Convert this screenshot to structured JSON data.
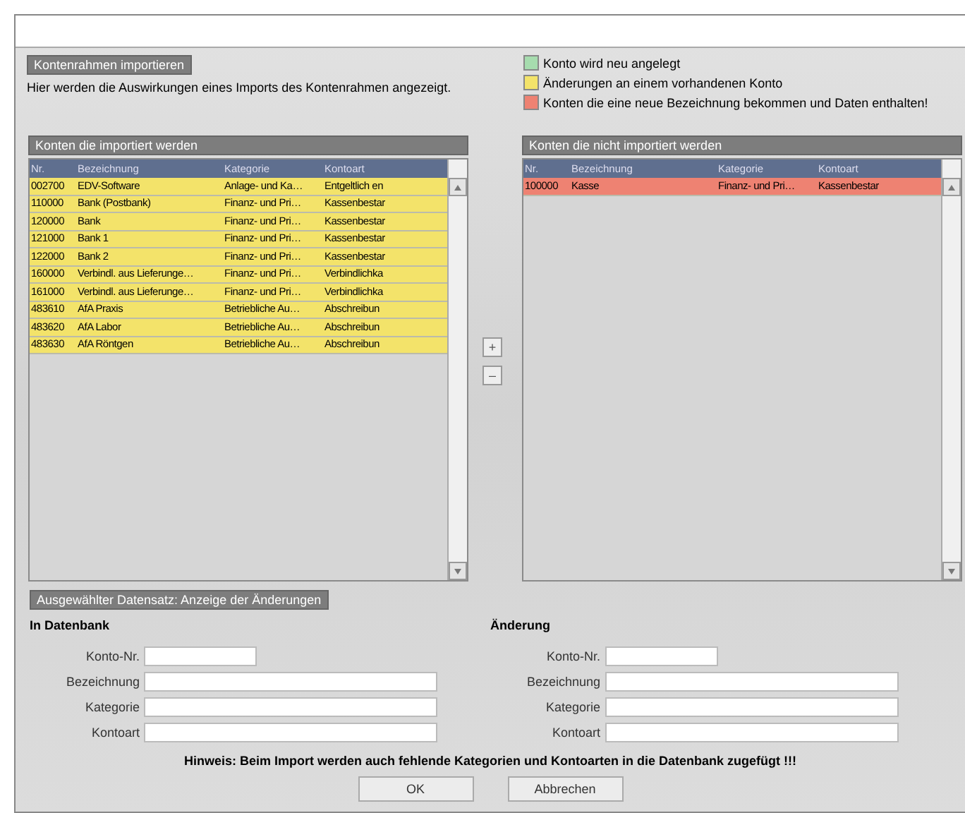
{
  "import_info": {
    "heading": "Kontenrahmen importieren",
    "description": "Hier werden die Auswirkungen eines Imports des Kontenrahmen angezeigt."
  },
  "legend": [
    {
      "label": "Konto wird neu angelegt",
      "color": "#a6dcae"
    },
    {
      "label": "Änderungen an einem vorhandenen Konto",
      "color": "#f3e36a"
    },
    {
      "label": "Konten die eine neue Bezeichnung bekommen und Daten enthalten!",
      "color": "#ee8272"
    }
  ],
  "imported_list": {
    "heading": "Konten die importiert werden",
    "columns": [
      "Nr.",
      "Bezeichnung",
      "Kategorie",
      "Kontoart"
    ],
    "rows": [
      {
        "cells": [
          "002700",
          "EDV-Software",
          "Anlage- und Ka…",
          "Entgeltlich en"
        ],
        "color": "#f3e36a"
      },
      {
        "cells": [
          "110000",
          "Bank (Postbank)",
          "Finanz- und Pri…",
          "Kassenbestar"
        ],
        "color": "#f3e36a"
      },
      {
        "cells": [
          "120000",
          "Bank",
          "Finanz- und Pri…",
          "Kassenbestar"
        ],
        "color": "#f3e36a"
      },
      {
        "cells": [
          "121000",
          "Bank 1",
          "Finanz- und Pri…",
          "Kassenbestar"
        ],
        "color": "#f3e36a"
      },
      {
        "cells": [
          "122000",
          "Bank 2",
          "Finanz- und Pri…",
          "Kassenbestar"
        ],
        "color": "#f3e36a"
      },
      {
        "cells": [
          "160000",
          "Verbindl. aus Lieferunge…",
          "Finanz- und Pri…",
          "Verbindlichka"
        ],
        "color": "#f3e36a"
      },
      {
        "cells": [
          "161000",
          "Verbindl. aus Lieferunge…",
          "Finanz- und Pri…",
          "Verbindlichka"
        ],
        "color": "#f3e36a"
      },
      {
        "cells": [
          "483610",
          "AfA Praxis",
          "Betriebliche Au…",
          "Abschreibun"
        ],
        "color": "#f3e36a"
      },
      {
        "cells": [
          "483620",
          "AfA Labor",
          "Betriebliche Au…",
          "Abschreibun"
        ],
        "color": "#f3e36a"
      },
      {
        "cells": [
          "483630",
          "AfA Röntgen",
          "Betriebliche Au…",
          "Abschreibun"
        ],
        "color": "#f3e36a"
      }
    ]
  },
  "move_buttons": [
    "+",
    "–"
  ],
  "not_imported_list": {
    "heading": "Konten die nicht importiert werden",
    "columns": [
      "Nr.",
      "Bezeichnung",
      "Kategorie",
      "Kontoart"
    ],
    "rows": [
      {
        "cells": [
          "100000",
          "Kasse",
          "Finanz- und Pri…",
          "Kassenbestar"
        ],
        "color": "#ee8272"
      }
    ]
  },
  "details": {
    "heading": "Ausgewählter Datensatz: Anzeige der Änderungen",
    "groups": [
      {
        "title": "In Datenbank",
        "fields": [
          {
            "label": "Konto-Nr.",
            "kind": "short"
          },
          {
            "label": "Bezeichnung",
            "kind": "long"
          },
          {
            "label": "Kategorie",
            "kind": "long"
          },
          {
            "label": "Kontoart",
            "kind": "long"
          }
        ]
      },
      {
        "title": "Änderung",
        "fields": [
          {
            "label": "Konto-Nr.",
            "kind": "short"
          },
          {
            "label": "Bezeichnung",
            "kind": "long"
          },
          {
            "label": "Kategorie",
            "kind": "long"
          },
          {
            "label": "Kontoart",
            "kind": "long"
          }
        ]
      }
    ],
    "hint": "Hinweis: Beim Import werden auch fehlende Kategorien und Kontoarten in die Datenbank zugefügt !!!"
  },
  "buttons": [
    "OK",
    "Abbrechen"
  ]
}
